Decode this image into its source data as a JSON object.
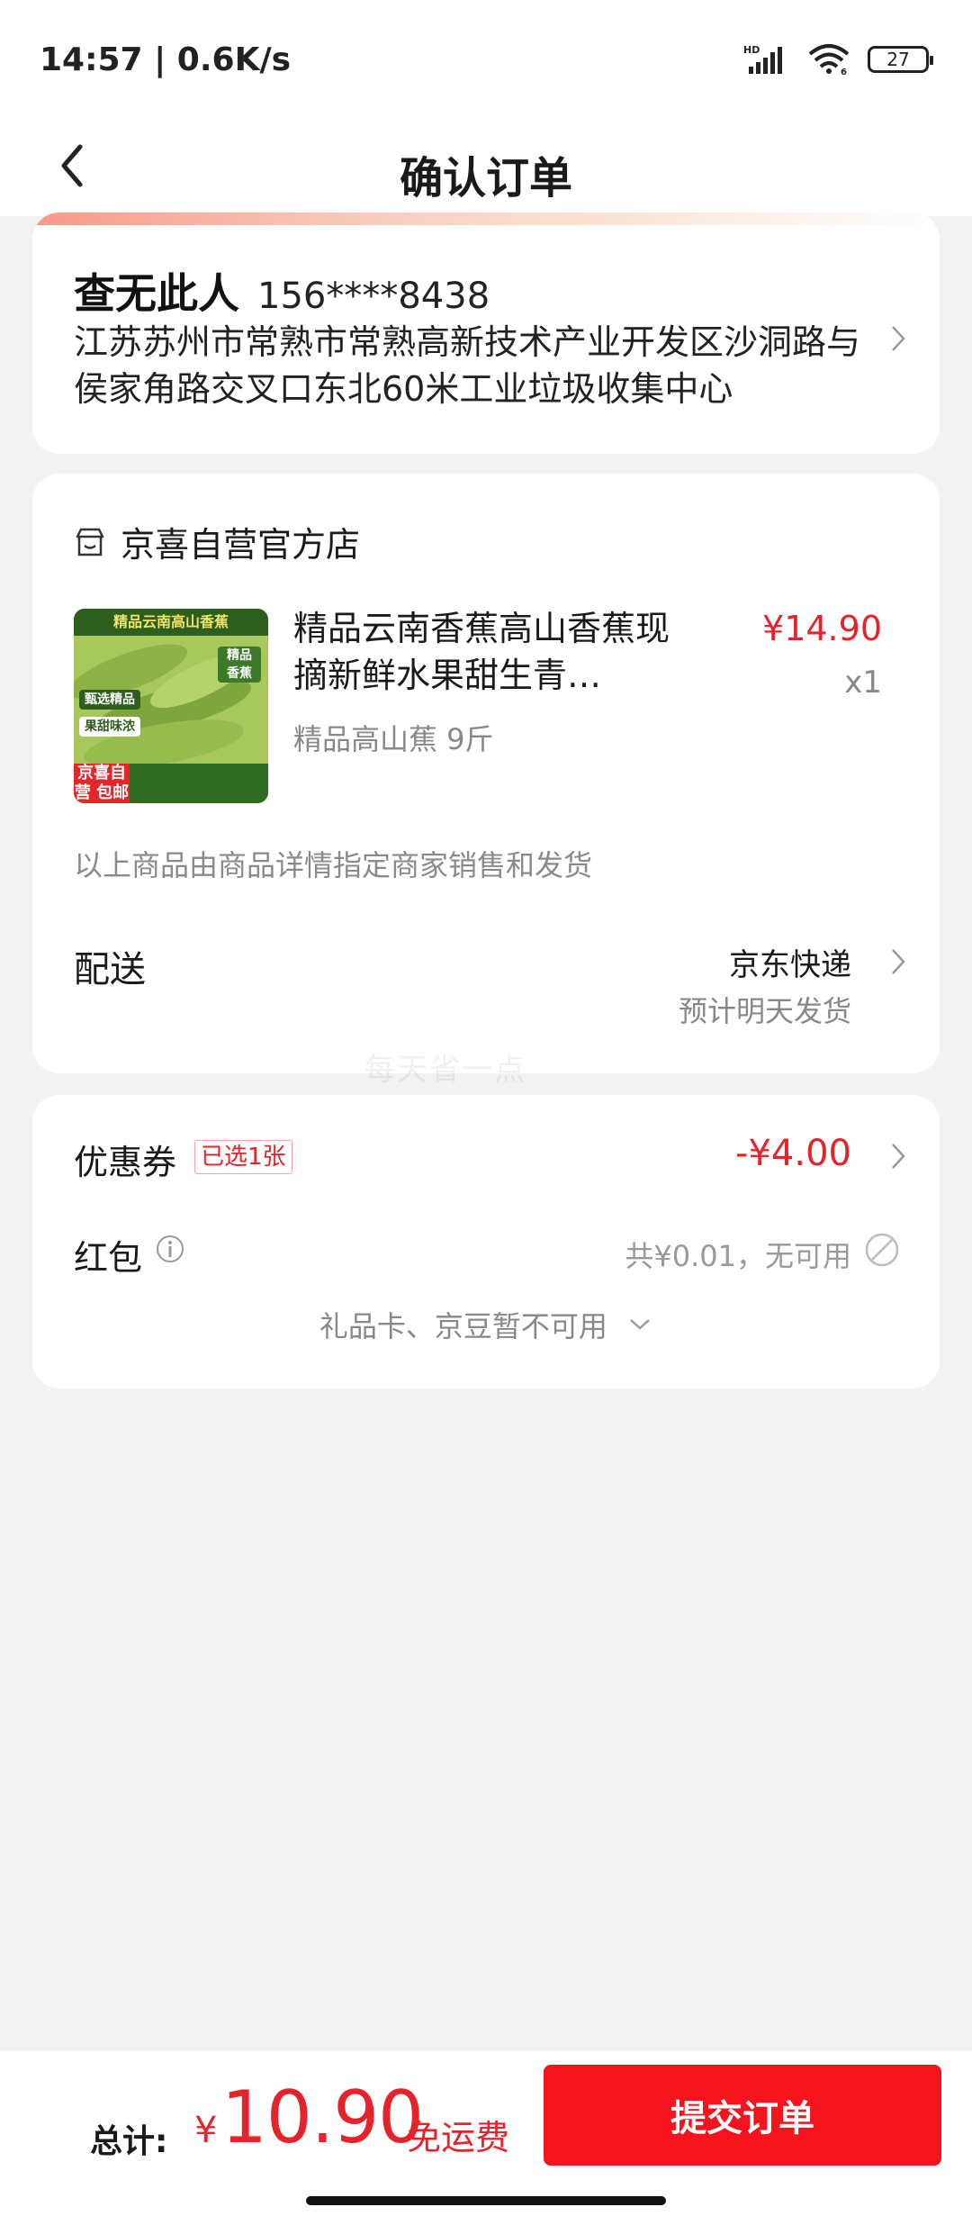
{
  "status_bar": {
    "time": "14:57 | 0.6K/s",
    "battery": "27",
    "icons": [
      "hd-signal-icon",
      "wifi-icon",
      "battery-icon"
    ]
  },
  "nav": {
    "title": "确认订单",
    "back_icon": "chevron-left-icon"
  },
  "address": {
    "name": "查无此人",
    "phone": "156****8438",
    "detail": "江苏苏州市常熟市常熟高新技术产业开发区沙洞路与侯家角路交叉口东北60米工业垃圾收集中心"
  },
  "shop": {
    "name": "京喜自营官方店",
    "icon": "store-icon",
    "product": {
      "title": "精品云南香蕉高山香蕉现摘新鲜水果甜生青…",
      "price": "¥14.90",
      "qty": "x1",
      "spec": "精品高山蕉 9斤",
      "image_banner": "精品云南高山香蕉",
      "image_badge_1": "精品香蕉",
      "image_badge_2": "甄选精品",
      "image_badge_3": "果甜味浓",
      "image_shipping": "京喜自营 包邮"
    },
    "seller_note": "以上商品由商品详情指定商家销售和发货",
    "delivery": {
      "label": "配送",
      "method": "京东快递",
      "eta": "预计明天发货"
    }
  },
  "watermark": "每天省一点",
  "discounts": {
    "coupon_label": "优惠券",
    "coupon_tag": "已选1张",
    "coupon_amount": "-¥4.00",
    "hongbao_label": "红包",
    "hongbao_value": "共¥0.01，无可用",
    "giftcard_text": "礼品卡、京豆暂不可用"
  },
  "footer": {
    "total_label": "总计:",
    "currency": "¥",
    "total_amount": "10.90",
    "free_shipping": "免运费",
    "submit_label": "提交订单"
  },
  "colors": {
    "accent_red": "#e4232b",
    "button_red": "#f5141e",
    "background": "#f2f2f2"
  }
}
